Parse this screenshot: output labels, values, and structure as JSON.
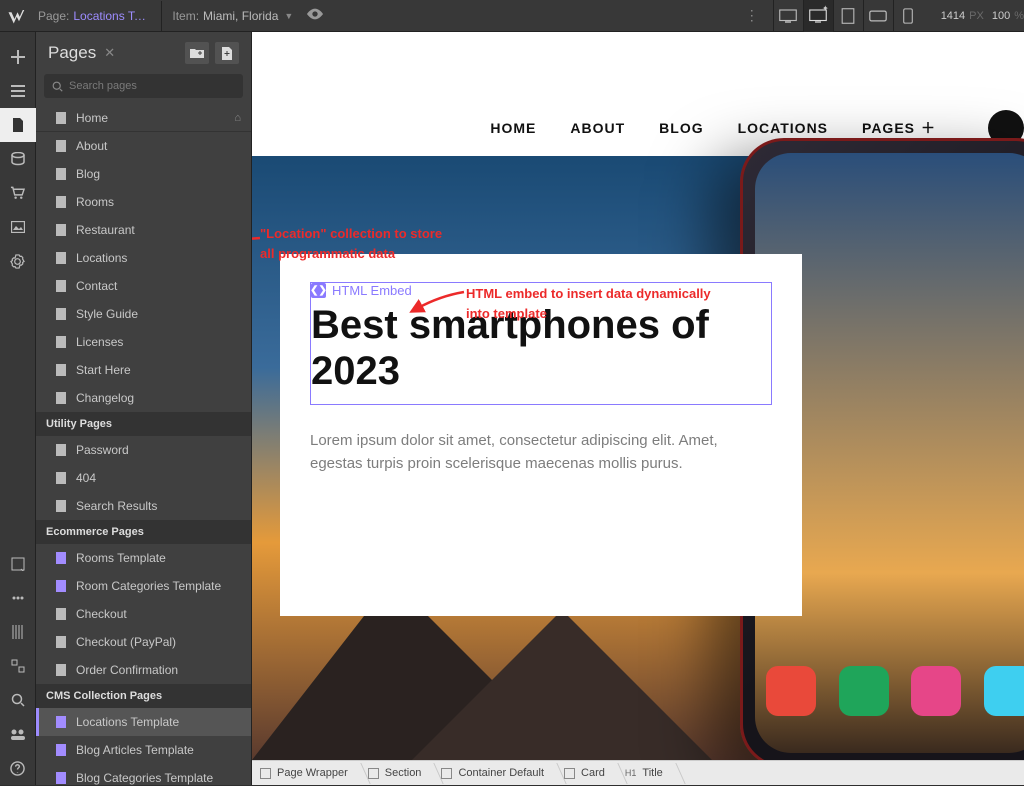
{
  "topbar": {
    "page_label": "Page:",
    "page_value": "Locations Te…",
    "item_label": "Item:",
    "item_value": "Miami, Florida",
    "width": "1414",
    "px": "PX",
    "zoom": "100",
    "pct": "%"
  },
  "pages_panel": {
    "title": "Pages",
    "search_placeholder": "Search pages",
    "static": [
      "Home",
      "About",
      "Blog",
      "Rooms",
      "Restaurant",
      "Locations",
      "Contact",
      "Style Guide",
      "Licenses",
      "Start Here",
      "Changelog"
    ],
    "sect_utility": "Utility Pages",
    "utility": [
      "Password",
      "404",
      "Search Results"
    ],
    "sect_ecom": "Ecommerce Pages",
    "ecom": [
      "Rooms Template",
      "Room Categories Template",
      "Checkout",
      "Checkout (PayPal)",
      "Order Confirmation"
    ],
    "sect_cms": "CMS Collection Pages",
    "cms": [
      "Locations Template",
      "Blog Articles Template",
      "Blog Categories Template"
    ]
  },
  "siteNav": {
    "items": [
      "HOME",
      "ABOUT",
      "BLOG",
      "LOCATIONS"
    ],
    "pages": "PAGES"
  },
  "card": {
    "embed_label": "HTML Embed",
    "title": "Best smartphones of 2023",
    "body": "Lorem ipsum dolor sit amet, consectetur adipiscing elit. Amet, egestas turpis proin scelerisque maecenas mollis purus."
  },
  "annotations": {
    "a1_l1": "\"Location\" collection to store",
    "a1_l2": "all programmatic data",
    "a2_l1": "HTML embed to insert data dynamically",
    "a2_l2": "into template"
  },
  "breadcrumb": {
    "items": [
      "Page Wrapper",
      "Section",
      "Container Default",
      "Card",
      "Title"
    ],
    "last_prefix": "H1"
  }
}
